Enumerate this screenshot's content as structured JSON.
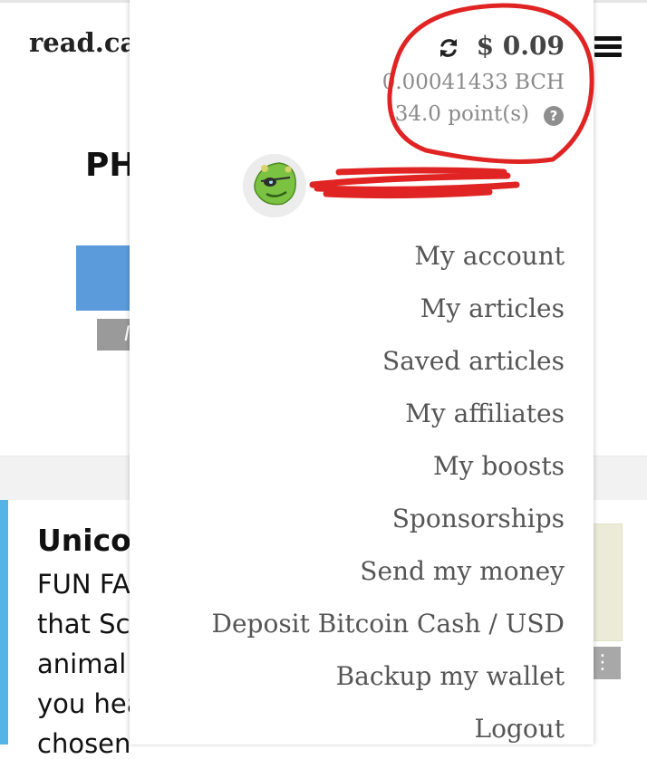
{
  "site": {
    "logo": "read.ca"
  },
  "background": {
    "heading": "PH",
    "gray_tag": "I",
    "article": {
      "title": "Unicor",
      "lines": [
        "FUN FA",
        "that Sc",
        "animal i",
        "you hea",
        "chosen"
      ],
      "more_label": "⋮"
    }
  },
  "wallet": {
    "usd": "$ 0.09",
    "bch": "0.00041433 BCH",
    "points": "34.0 point(s)",
    "help_label": "?"
  },
  "menu": {
    "items": [
      {
        "label": "My account"
      },
      {
        "label": "My articles"
      },
      {
        "label": "Saved articles"
      },
      {
        "label": "My affiliates"
      },
      {
        "label": "My boosts"
      },
      {
        "label": "Sponsorships"
      },
      {
        "label": "Send my money"
      },
      {
        "label": "Deposit Bitcoin Cash / USD"
      },
      {
        "label": "Backup my wallet"
      },
      {
        "label": "Logout"
      }
    ]
  },
  "icons": {
    "refresh": "refresh-icon",
    "hamburger": "hamburger-menu-icon",
    "avatar": "green-monster-avatar"
  },
  "colors": {
    "accent_blue": "#5b9bdb",
    "article_accent": "#55b3e6",
    "annotation_red": "#e02424",
    "menu_text": "#555555"
  }
}
